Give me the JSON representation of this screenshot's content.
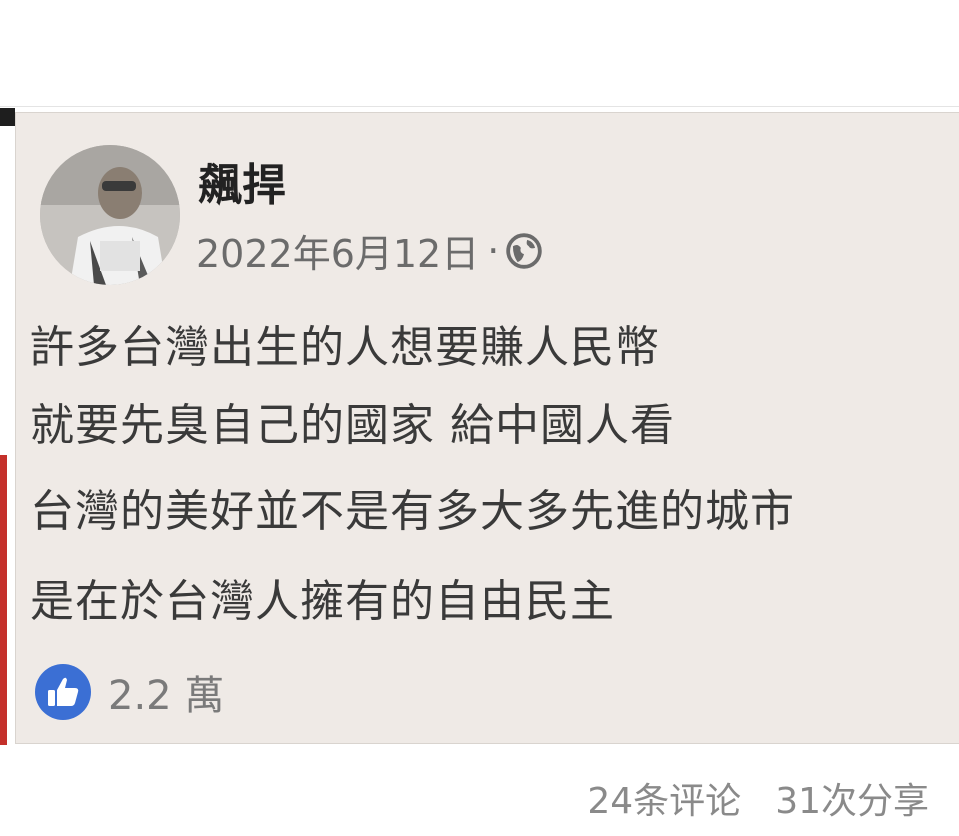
{
  "post": {
    "author": "飆捍",
    "date": "2022年6月12日",
    "separator": "·",
    "privacy_icon": "globe-icon",
    "lines": [
      "許多台灣出生的人想要賺人民幣",
      "就要先臭自己的國家 給中國人看",
      "台灣的美好並不是有多大多先進的城市",
      "是在於台灣人擁有的自由民主"
    ],
    "reaction_icon": "like-icon",
    "reaction_count": "2.2 萬"
  },
  "footer": {
    "comments": "24条评论",
    "shares": "31次分享"
  },
  "colors": {
    "card_background": "#efeae6",
    "like_blue": "#3b6fd4",
    "accent_red": "#c4302b"
  }
}
